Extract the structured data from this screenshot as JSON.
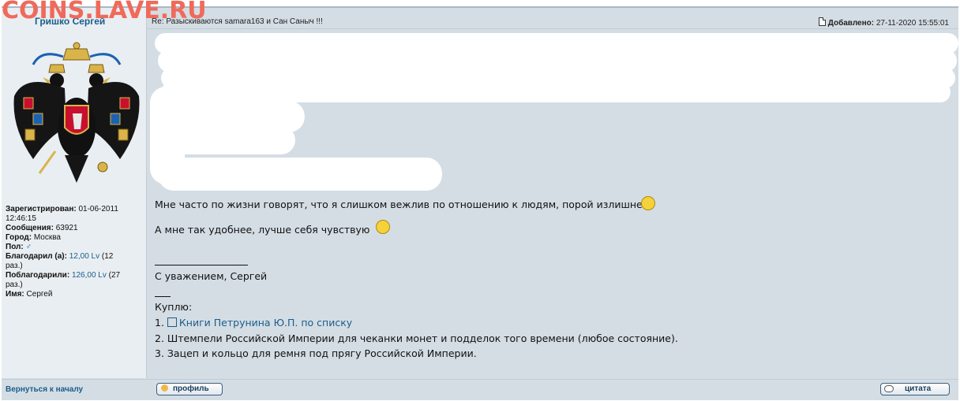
{
  "watermark": "COINS.LAVE.RU",
  "post": {
    "author": "Гришко Сергей",
    "subject": "Re: Разыскиваются samara163 и Сан Саныч !!!",
    "added_label": "Добавлено:",
    "added_value": "27-11-2020 15:55:01"
  },
  "profile": {
    "registered_label": "Зарегистрирован:",
    "registered_value_1": "01-06-2011",
    "registered_value_2": "12:46:15",
    "messages_label": "Сообщения:",
    "messages_value": "63921",
    "city_label": "Город:",
    "city_value": "Москва",
    "gender_label": "Пол:",
    "gender_icon": "male-icon",
    "thanked_label": "Благодарил (а):",
    "thanked_amount": "12,00 Lv",
    "thanked_count_1": "(12",
    "thanked_count_2": "раз.)",
    "got_thanks_label": "Поблагодарили:",
    "got_thanks_amount": "126,00 Lv",
    "got_thanks_count_1": "(27",
    "got_thanks_count_2": "раз.)",
    "name_label": "Имя:",
    "name_value": "Сергей"
  },
  "body": {
    "line1": "Мне часто по жизни говорят, что я слишком вежлив по отношению к людям, порой излишне.",
    "line2": "А мне так удобнее, лучше себя чувствую",
    "signature_regards": "С уважением, Сергей",
    "buy_title": "Куплю:",
    "item1_num": "1.",
    "item1_link": "Книги Петрунина Ю.П. по списку",
    "item2": "2. Штемпели Российской Империи для чеканки монет и подделок того времени (любое состояние).",
    "item3": "3. Зацеп и кольцо для ремня под прягу Российской Империи."
  },
  "footer": {
    "back_link": "Вернуться к началу",
    "profile_button": "профиль",
    "quote_button": "цитата"
  },
  "colors": {
    "link": "#1a5d8a",
    "watermark": "#f06a5a",
    "background": "#d4dde4"
  }
}
